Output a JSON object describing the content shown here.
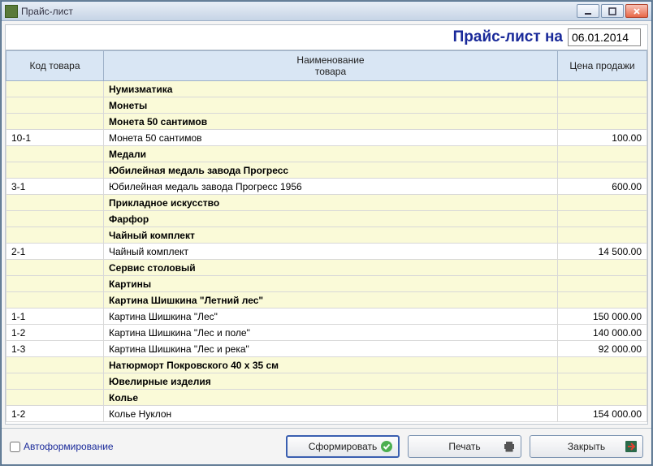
{
  "window_title": "Прайс-лист",
  "header": {
    "title": "Прайс-лист на",
    "date": "06.01.2014"
  },
  "columns": {
    "code": "Код товара",
    "name_l1": "Наименование",
    "name_l2": "товара",
    "price": "Цена продажи"
  },
  "rows": [
    {
      "type": "group",
      "name": "Нумизматика"
    },
    {
      "type": "group",
      "name": "Монеты"
    },
    {
      "type": "group",
      "name": "Монета 50 сантимов"
    },
    {
      "type": "item",
      "code": "10-1",
      "name": "Монета 50 сантимов",
      "price": "100.00"
    },
    {
      "type": "group",
      "name": "Медали"
    },
    {
      "type": "group",
      "name": "Юбилейная медаль завода Прогресс"
    },
    {
      "type": "item",
      "code": "3-1",
      "name": "Юбилейная медаль завода Прогресс  1956",
      "price": "600.00"
    },
    {
      "type": "group",
      "name": "Прикладное искусство"
    },
    {
      "type": "group",
      "name": "Фарфор"
    },
    {
      "type": "group",
      "name": "Чайный комплект"
    },
    {
      "type": "item",
      "code": "2-1",
      "name": "Чайный комплект",
      "price": "14 500.00"
    },
    {
      "type": "group",
      "name": "Сервис столовый"
    },
    {
      "type": "group",
      "name": "Картины"
    },
    {
      "type": "group",
      "name": "Картина Шишкина \"Летний лес\""
    },
    {
      "type": "item",
      "code": "1-1",
      "name": "Картина   Шишкина \"Лес\"",
      "price": "150 000.00"
    },
    {
      "type": "item",
      "code": "1-2",
      "name": "Картина   Шишкина \"Лес и поле\"",
      "price": "140 000.00"
    },
    {
      "type": "item",
      "code": "1-3",
      "name": "Картина   Шишкина \"Лес и река\"",
      "price": "92 000.00"
    },
    {
      "type": "group",
      "name": "Натюрморт Покровского 40 х 35 см"
    },
    {
      "type": "group",
      "name": "Ювелирные изделия"
    },
    {
      "type": "group",
      "name": "Колье"
    },
    {
      "type": "item",
      "code": "1-2",
      "name": "Колье Нуклон",
      "price": "154 000.00"
    }
  ],
  "footer": {
    "autoform_label": "Автоформирование",
    "generate": "Сформировать",
    "print": "Печать",
    "close": "Закрыть"
  }
}
